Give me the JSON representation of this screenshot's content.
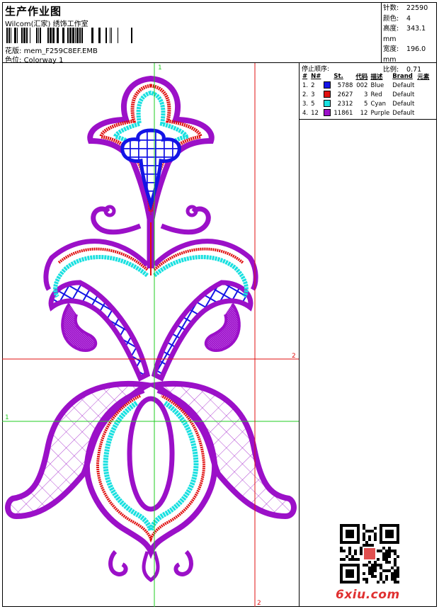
{
  "header": {
    "title": "生产作业图",
    "company": "Wilcom(汇家) 绣饰工作室",
    "file_label": "花版:",
    "file_value": "mem_F259C8EF.EMB",
    "colorway_label": "色位:",
    "colorway_value": "Colorway 1"
  },
  "stats": [
    {
      "label": "针数:",
      "value": "22590"
    },
    {
      "label": "颜色:",
      "value": "4"
    },
    {
      "label": "高度:",
      "value": "343.1 mm"
    },
    {
      "label": "宽度:",
      "value": "196.0 mm"
    },
    {
      "label": "比例:",
      "value": "0.71"
    }
  ],
  "stop_sequence": {
    "title": "停止顺序:",
    "headers": [
      "#",
      "N#",
      "St.",
      "代码",
      "描述",
      "Brand",
      "元素"
    ],
    "rows": [
      {
        "idx": "1.",
        "n": "2",
        "color": "#1414e6",
        "st": "5788",
        "code": "002",
        "desc": "Blue",
        "brand": "Default"
      },
      {
        "idx": "2.",
        "n": "3",
        "color": "#e01010",
        "st": "2627",
        "code": "3",
        "desc": "Red",
        "brand": "Default"
      },
      {
        "idx": "3.",
        "n": "5",
        "color": "#19e0e0",
        "st": "2312",
        "code": "5",
        "desc": "Cyan",
        "brand": "Default"
      },
      {
        "idx": "4.",
        "n": "12",
        "color": "#9b10c8",
        "st": "11861",
        "code": "12",
        "desc": "Purple",
        "brand": "Default"
      }
    ]
  },
  "guides": {
    "v_green": "1",
    "h_red": "2",
    "h_green": "1",
    "v_red": "2"
  },
  "watermark": "6xiu.com",
  "colors": {
    "purple": "#9b10c8",
    "blue": "#1414e6",
    "red": "#e01010",
    "cyan": "#19e0e0",
    "green": "#22cc22"
  }
}
